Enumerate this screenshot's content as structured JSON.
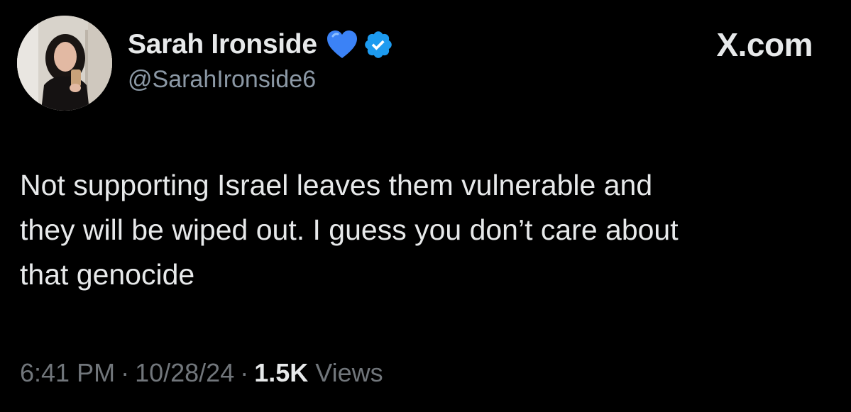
{
  "author": {
    "display_name": "Sarah Ironside",
    "handle": "@SarahIronside6",
    "name_emoji": "blue-heart-icon",
    "verified": true
  },
  "brand": "X.com",
  "tweet": {
    "lines": [
      "Not supporting Israel leaves them vulnerable and",
      "they will be wiped out. I guess you don’t care about",
      "that genocide"
    ]
  },
  "meta": {
    "time": "6:41 PM",
    "separator": "·",
    "date": "10/28/24",
    "views_count": "1.5K",
    "views_label": "Views"
  },
  "colors": {
    "background": "#000000",
    "text": "#e7e9ea",
    "secondary": "#71767b",
    "verified_blue": "#1d9bf0",
    "heart_blue": "#3b82f6"
  }
}
